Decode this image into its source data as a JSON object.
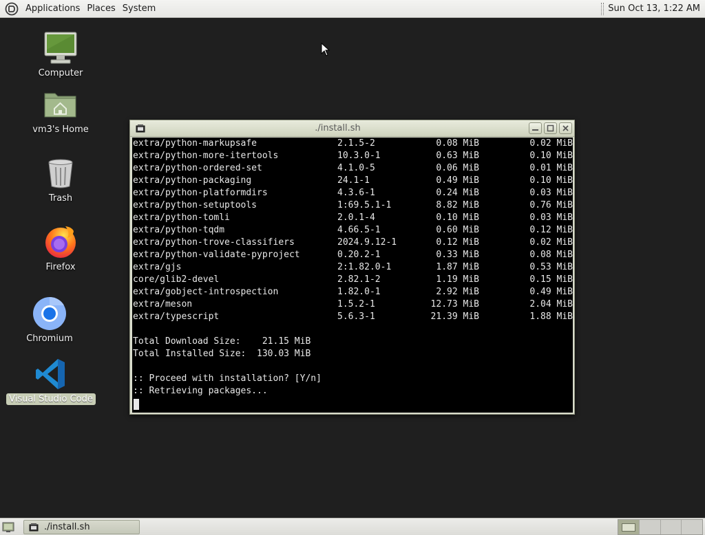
{
  "top_panel": {
    "menus": [
      "Applications",
      "Places",
      "System"
    ],
    "clock": "Sun Oct 13,  1:22 AM"
  },
  "desktop": {
    "icons": [
      {
        "label": "Computer",
        "icon": "computer-icon"
      },
      {
        "label": "vm3's Home",
        "icon": "home-folder-icon"
      },
      {
        "label": "Trash",
        "icon": "trash-icon"
      },
      {
        "label": "Firefox",
        "icon": "firefox-icon"
      },
      {
        "label": "Chromium",
        "icon": "chromium-icon"
      },
      {
        "label": "Visual Studio Code",
        "icon": "vscode-icon",
        "selected": true
      }
    ]
  },
  "terminal": {
    "title": "./install.sh",
    "packages": [
      {
        "name": "extra/python-markupsafe",
        "version": "2.1.5-2",
        "download": "0.08 MiB",
        "installed": "0.02 MiB"
      },
      {
        "name": "extra/python-more-itertools",
        "version": "10.3.0-1",
        "download": "0.63 MiB",
        "installed": "0.10 MiB"
      },
      {
        "name": "extra/python-ordered-set",
        "version": "4.1.0-5",
        "download": "0.06 MiB",
        "installed": "0.01 MiB"
      },
      {
        "name": "extra/python-packaging",
        "version": "24.1-1",
        "download": "0.49 MiB",
        "installed": "0.10 MiB"
      },
      {
        "name": "extra/python-platformdirs",
        "version": "4.3.6-1",
        "download": "0.24 MiB",
        "installed": "0.03 MiB"
      },
      {
        "name": "extra/python-setuptools",
        "version": "1:69.5.1-1",
        "download": "8.82 MiB",
        "installed": "0.76 MiB"
      },
      {
        "name": "extra/python-tomli",
        "version": "2.0.1-4",
        "download": "0.10 MiB",
        "installed": "0.03 MiB"
      },
      {
        "name": "extra/python-tqdm",
        "version": "4.66.5-1",
        "download": "0.60 MiB",
        "installed": "0.12 MiB"
      },
      {
        "name": "extra/python-trove-classifiers",
        "version": "2024.9.12-1",
        "download": "0.12 MiB",
        "installed": "0.02 MiB"
      },
      {
        "name": "extra/python-validate-pyproject",
        "version": "0.20.2-1",
        "download": "0.33 MiB",
        "installed": "0.08 MiB"
      },
      {
        "name": "extra/gjs",
        "version": "2:1.82.0-1",
        "download": "1.87 MiB",
        "installed": "0.53 MiB"
      },
      {
        "name": "core/glib2-devel",
        "version": "2.82.1-2",
        "download": "1.19 MiB",
        "installed": "0.15 MiB"
      },
      {
        "name": "extra/gobject-introspection",
        "version": "1.82.0-1",
        "download": "2.92 MiB",
        "installed": "0.49 MiB"
      },
      {
        "name": "extra/meson",
        "version": "1.5.2-1",
        "download": "12.73 MiB",
        "installed": "2.04 MiB"
      },
      {
        "name": "extra/typescript",
        "version": "5.6.3-1",
        "download": "21.39 MiB",
        "installed": "1.88 MiB"
      }
    ],
    "summary": [
      "Total Download Size:    21.15 MiB",
      "Total Installed Size:  130.03 MiB"
    ],
    "messages": [
      ":: Proceed with installation? [Y/n]",
      ":: Retrieving packages..."
    ]
  },
  "taskbar": {
    "task_label": "./install.sh"
  }
}
